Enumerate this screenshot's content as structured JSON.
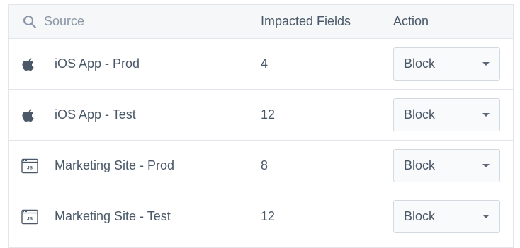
{
  "header": {
    "search_icon": "search-icon",
    "source_placeholder": "Source",
    "fields_label": "Impacted Fields",
    "action_label": "Action"
  },
  "rows": [
    {
      "icon": "apple-icon",
      "name": "iOS App - Prod",
      "count": "4",
      "action": "Block"
    },
    {
      "icon": "apple-icon",
      "name": "iOS App - Test",
      "count": "12",
      "action": "Block"
    },
    {
      "icon": "js-window-icon",
      "name": "Marketing Site - Prod",
      "count": "8",
      "action": "Block"
    },
    {
      "icon": "js-window-icon",
      "name": "Marketing Site - Test",
      "count": "12",
      "action": "Block"
    }
  ],
  "icon_label_js": "JS",
  "colors": {
    "header_bg": "#f6f7f9",
    "border": "#e2e6ea",
    "text": "#4a5868",
    "muted": "#8a97a6"
  }
}
